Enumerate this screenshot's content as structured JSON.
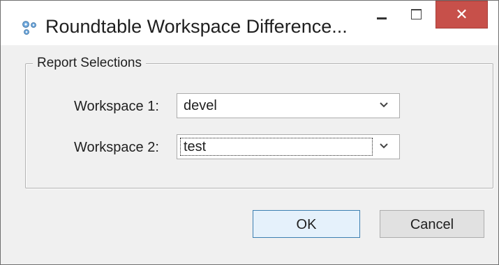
{
  "window": {
    "title": "Roundtable Workspace Difference...",
    "minimize_icon": "minimize-icon",
    "maximize_icon": "maximize-icon",
    "close_icon": "close-icon",
    "close_glyph": "✕",
    "close_color": "#c7504a"
  },
  "group": {
    "title": "Report Selections"
  },
  "fields": {
    "workspace1": {
      "label": "Workspace 1:",
      "value": "devel"
    },
    "workspace2": {
      "label": "Workspace 2:",
      "value": "test"
    }
  },
  "buttons": {
    "ok": "OK",
    "cancel": "Cancel"
  }
}
